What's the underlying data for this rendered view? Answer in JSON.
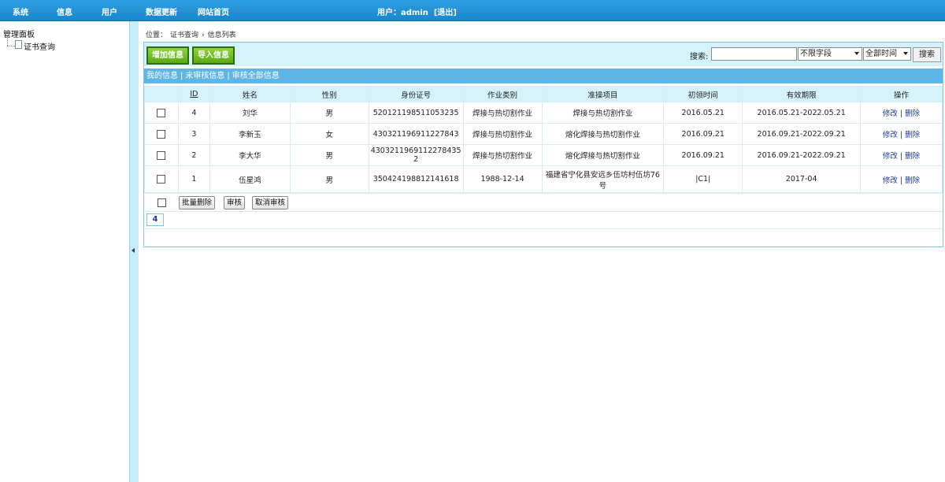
{
  "nav": {
    "items": [
      "系统",
      "信息",
      "用户",
      "数据更新",
      "网站首页"
    ],
    "user_label": "用户：admin",
    "logout_label": "[退出]"
  },
  "tree": {
    "root_label": "管理面板",
    "leaf_label": "证书查询"
  },
  "breadcrumb": {
    "position_label": "位置：",
    "items": [
      "证书查询",
      "信息列表"
    ]
  },
  "toolbar": {
    "add_label": "增加信息",
    "import_label": "导入信息",
    "search_label": "搜索:",
    "search_value": "",
    "field_select": "不限字段",
    "time_select": "全部时间",
    "search_button": "搜索"
  },
  "filters": {
    "mine": "我的信息",
    "unreviewed": "未审核信息",
    "review_all": "审核全部信息",
    "separator": "|"
  },
  "table": {
    "headers": [
      "ID",
      "姓名",
      "性别",
      "身份证号",
      "作业类别",
      "准操项目",
      "初领时间",
      "有效期限",
      "操作"
    ],
    "rows": [
      {
        "id": "4",
        "name": "刘华",
        "gender": "男",
        "id_number": "520121198511053235",
        "category": "焊接与热切割作业",
        "project": "焊接与热切割作业",
        "first_date": "2016.05.21",
        "valid": "2016.05.21-2022.05.21"
      },
      {
        "id": "3",
        "name": "李新玉",
        "gender": "女",
        "id_number": "430321196911227843",
        "category": "焊接与热切割作业",
        "project": "熔化焊接与热切割作业",
        "first_date": "2016.09.21",
        "valid": "2016.09.21-2022.09.21"
      },
      {
        "id": "2",
        "name": "李大华",
        "gender": "男",
        "id_number": "4303211969112278435​2",
        "category": "焊接与热切割作业",
        "project": "熔化焊接与热切割作业",
        "first_date": "2016.09.21",
        "valid": "2016.09.21-2022.09.21"
      },
      {
        "id": "1",
        "name": "伍星鸿",
        "gender": "男",
        "id_number": "350424198812141618",
        "category": "1988-12-14",
        "project": "福建省宁化县安远乡伍坊村伍坊76号",
        "first_date": "|C1|",
        "valid": "2017-04"
      }
    ],
    "edit_label": "修改",
    "delete_label": "删除",
    "op_separator": "|"
  },
  "bulk": {
    "delete_label": "批量删除",
    "review_label": "审核",
    "cancel_review_label": "取消审核"
  },
  "pager": {
    "current": "4"
  },
  "colors": {
    "topbar": "#1a86cc",
    "accent_green": "#5aa814",
    "filterbar": "#5fb5e6",
    "toolbar_bg": "#d5f1fb"
  }
}
